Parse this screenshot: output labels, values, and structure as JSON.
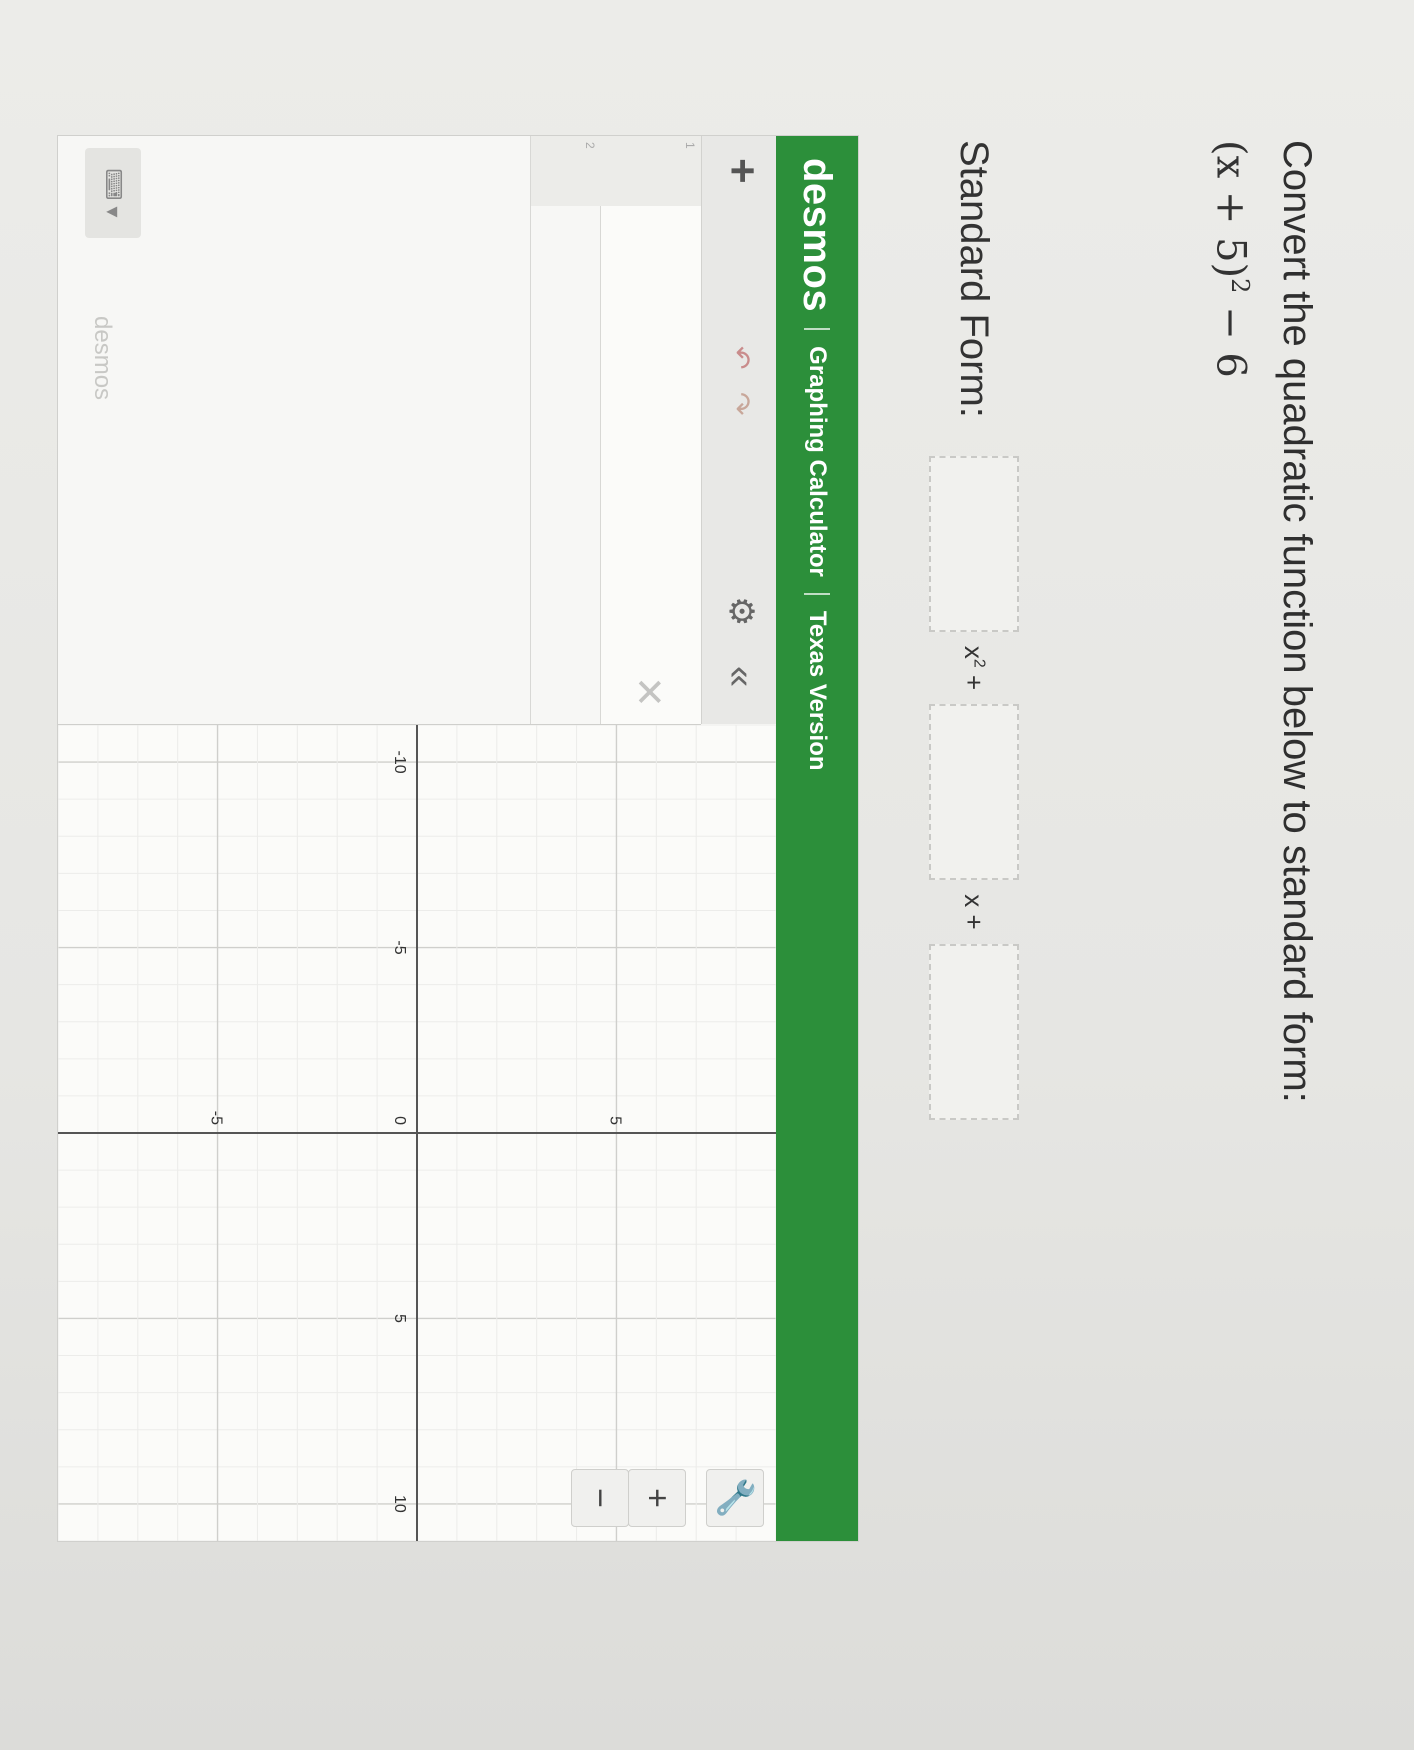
{
  "question": {
    "prompt": "Convert the quadratic function below to standard form:",
    "expression_base": "(x + 5)",
    "expression_exponent": "2",
    "expression_tail": " − 6"
  },
  "answer": {
    "label": "Standard Form:",
    "term_a_text": "x",
    "term_a_exp": "2",
    "term_a_plus": " +",
    "term_b_text": "x +",
    "values": [
      "",
      "",
      ""
    ]
  },
  "desmos": {
    "logo": "desmos",
    "title": "Graphing Calculator",
    "version": "Texas Version",
    "footer_logo": "desmos",
    "expression_row_numbers": [
      "1",
      "2"
    ],
    "icons": {
      "add": "plus-icon",
      "undo": "undo-icon",
      "redo": "redo-icon",
      "settings": "gear-icon",
      "collapse": "double-chevron-left-icon",
      "delete": "close-icon",
      "keypad": "keyboard-icon",
      "graph_settings": "wrench-icon",
      "zoom_in": "plus-icon",
      "zoom_out": "minus-icon"
    },
    "graph": {
      "x_range": [
        -11,
        11
      ],
      "y_range": [
        -9,
        9
      ],
      "x_ticks": [
        "-10",
        "-5",
        "0",
        "5",
        "10"
      ],
      "y_ticks": [
        "5",
        "-5"
      ],
      "grid": true,
      "accent_color": "#2c8f3a"
    }
  }
}
